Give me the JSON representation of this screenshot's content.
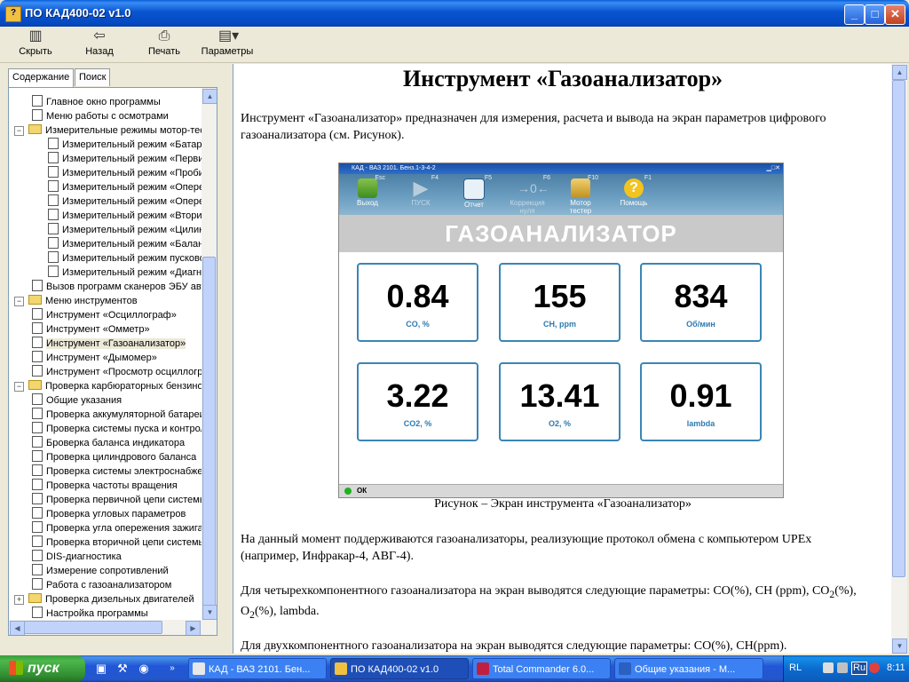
{
  "window": {
    "title": "ПО КАД400-02 v1.0"
  },
  "toolbar": {
    "hide": "Скрыть",
    "back": "Назад",
    "print": "Печать",
    "options": "Параметры"
  },
  "tabs": {
    "contents": "Содержание",
    "search": "Поиск"
  },
  "tree": {
    "items": [
      {
        "label": "Главное окно программы"
      },
      {
        "label": "Меню работы с осмотрами"
      },
      {
        "label": "Измерительные режимы мотор-тестера"
      },
      {
        "label": "Измерительный режим «Батарея»"
      },
      {
        "label": "Измерительный режим «Первичное напряжение»"
      },
      {
        "label": "Измерительный режим «Пробивное напряжение»"
      },
      {
        "label": "Измерительный режим «Опережение зажигания»"
      },
      {
        "label": "Измерительный режим «Опережение впрыска»"
      },
      {
        "label": "Измерительный режим «Вторичное напряжение»"
      },
      {
        "label": "Измерительный режим «Цилиндровый баланс»"
      },
      {
        "label": "Измерительный режим «Баланс индикатора»"
      },
      {
        "label": "Измерительный режим пусковой"
      },
      {
        "label": "Измерительный режим «Диагностика»"
      },
      {
        "label": "Вызов программ сканеров ЭБУ автомобиля"
      },
      {
        "label": "Меню инструментов"
      },
      {
        "label": "Инструмент «Осциллограф»"
      },
      {
        "label": "Инструмент «Омметр»"
      },
      {
        "label": "Инструмент «Газоанализатор»"
      },
      {
        "label": "Инструмент «Дымомер»"
      },
      {
        "label": "Инструмент «Просмотр осциллограмм»"
      },
      {
        "label": "Проверка карбюраторных бензиновых двигателей"
      },
      {
        "label": "Общие указания"
      },
      {
        "label": "Проверка аккумуляторной батареи"
      },
      {
        "label": "Проверка системы пуска и контроля"
      },
      {
        "label": "Броверка баланса индикатора"
      },
      {
        "label": "Проверка цилиндрового баланса"
      },
      {
        "label": "Проверка системы электроснабжения"
      },
      {
        "label": "Проверка частоты вращения"
      },
      {
        "label": "Проверка первичной цепи системы"
      },
      {
        "label": "Проверка угловых параметров"
      },
      {
        "label": "Проверка угла опережения зажигания"
      },
      {
        "label": "Проверка вторичной цепи системы"
      },
      {
        "label": "DIS-диагностика"
      },
      {
        "label": "Измерение сопротивлений"
      },
      {
        "label": "Работа с газоанализатором"
      },
      {
        "label": "Проверка дизельных двигателей"
      },
      {
        "label": "Настройка программы"
      }
    ]
  },
  "content": {
    "heading": "Инструмент «Газоанализатор»",
    "intro": "Инструмент «Газоанализатор» предназначен для измерения, расчета и вывода на экран параметров цифрового газоанализатора (см. Рисунок).",
    "caption": "Рисунок – Экран инструмента «Газоанализатор»",
    "p2": "На данный момент поддерживаются газоанализаторы, реализующие протокол обмена с компьютером UPEx (например, Инфракар-4, АВГ-4).",
    "p3a": "Для четырехкомпонентного газоанализатора на экран выводятся следующие параметры: CO(%), CH (ppm), CO",
    "p3sub1": "2",
    "p3b": "(%), O",
    "p3sub2": "2",
    "p3c": "(%), lambda.",
    "p4": "Для двухкомпонентного газоанализатора на экран выводятся следующие параметры: CO(%), CH(ppm)."
  },
  "figure": {
    "title": "КАД - ВАЗ 2101. Бенз.1-3-4-2",
    "buttons": [
      {
        "label": "Выход",
        "key": "Esc"
      },
      {
        "label": "ПУСК",
        "key": "F4"
      },
      {
        "label": "Отчет",
        "key": "F5"
      },
      {
        "label": "Коррекция нуля",
        "key": "F6"
      },
      {
        "label": "Мотор тестер",
        "key": "F10"
      },
      {
        "label": "Помощь",
        "key": "F1"
      }
    ],
    "header": "ГАЗОАНАЛИЗАТОР",
    "tiles": [
      {
        "value": "0.84",
        "label": "CO, %"
      },
      {
        "value": "155",
        "label": "CH, ppm"
      },
      {
        "value": "834",
        "label": "Об/мин"
      },
      {
        "value": "3.22",
        "label": "CO2, %"
      },
      {
        "value": "13.41",
        "label": "O2, %"
      },
      {
        "value": "0.91",
        "label": "lambda"
      }
    ],
    "status": "ОК"
  },
  "taskbar": {
    "start": "пуск",
    "tasks": [
      {
        "label": "КАД - ВАЗ 2101. Бен..."
      },
      {
        "label": "ПО КАД400-02 v1.0"
      },
      {
        "label": "Total Commander 6.0..."
      },
      {
        "label": "Общие указания - M..."
      }
    ],
    "lang1": "RL",
    "lang2": "Ru",
    "time": "8:11"
  }
}
